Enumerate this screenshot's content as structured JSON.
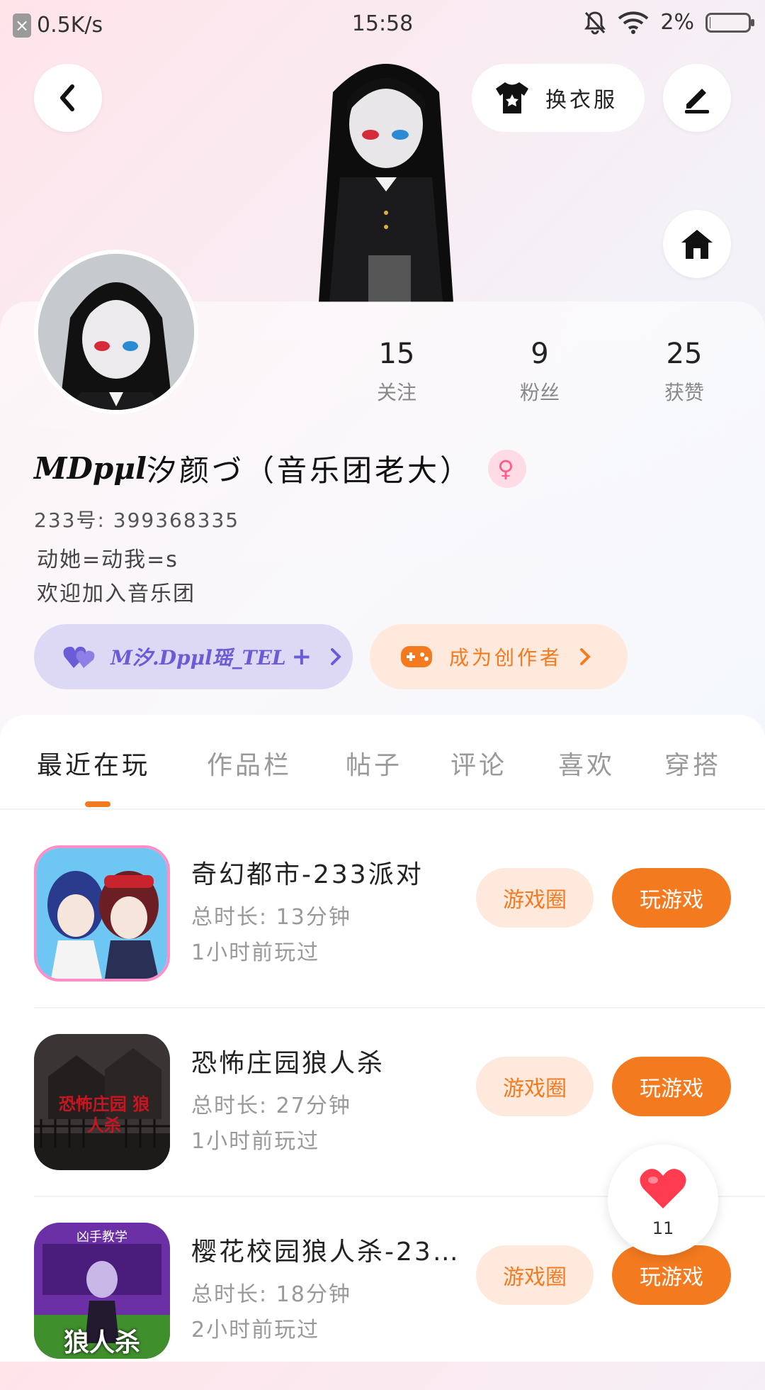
{
  "status_bar": {
    "net_speed": "0.5K/s",
    "time": "15:58",
    "battery": "2%",
    "battery_level": 0.02
  },
  "header": {
    "outfit_label": "换衣服"
  },
  "profile": {
    "stats": [
      {
        "num": "15",
        "label": "关注"
      },
      {
        "num": "9",
        "label": "粉丝"
      },
      {
        "num": "25",
        "label": "获赞"
      }
    ],
    "name_prefix": "MDpμl",
    "name": "汐颜づ（音乐团老大）",
    "gender_icon": "female-icon",
    "id_line": "233号: 399368335",
    "bio": [
      "动她=动我=s",
      "欢迎加入音乐团"
    ],
    "relation_tag": "M汐.Dpμl瑶_TEL",
    "creator_label": "成为创作者"
  },
  "tabs": [
    {
      "label": "最近在玩",
      "active": true
    },
    {
      "label": "作品栏",
      "active": false
    },
    {
      "label": "帖子",
      "active": false
    },
    {
      "label": "评论",
      "active": false
    },
    {
      "label": "喜欢",
      "active": false
    },
    {
      "label": "穿搭",
      "active": false
    }
  ],
  "games": [
    {
      "title": "奇幻都市-233派对",
      "duration": "总时长: 13分钟",
      "last_played": "1小时前玩过",
      "circle_btn": "游戏圈",
      "play_btn": "玩游戏"
    },
    {
      "title": "恐怖庄园狼人杀",
      "duration": "总时长: 27分钟",
      "last_played": "1小时前玩过",
      "circle_btn": "游戏圈",
      "play_btn": "玩游戏",
      "thumb_text": "恐怖庄园 狼人杀"
    },
    {
      "title": "樱花校园狼人杀-23…",
      "duration": "总时长: 18分钟",
      "last_played": "2小时前玩过",
      "circle_btn": "游戏圈",
      "play_btn": "玩游戏",
      "thumb_top": "凶手教学",
      "thumb_text": "狼人杀"
    }
  ],
  "like_fab": {
    "count": "11"
  },
  "colors": {
    "accent": "#f47a1f",
    "purple": "#6a5bd6",
    "pink": "#ff5a8a"
  }
}
